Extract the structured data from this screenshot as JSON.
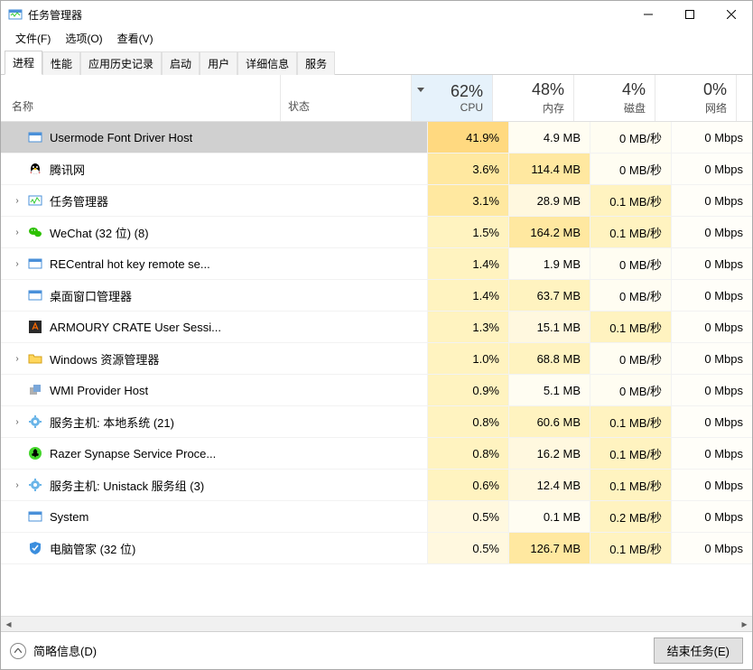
{
  "window": {
    "title": "任务管理器"
  },
  "menu": {
    "file": "文件(F)",
    "options": "选项(O)",
    "view": "查看(V)"
  },
  "tabs": {
    "processes": "进程",
    "performance": "性能",
    "app_history": "应用历史记录",
    "startup": "启动",
    "users": "用户",
    "details": "详细信息",
    "services": "服务"
  },
  "columns": {
    "name": "名称",
    "status": "状态",
    "cpu": {
      "pct": "62%",
      "label": "CPU"
    },
    "memory": {
      "pct": "48%",
      "label": "内存"
    },
    "disk": {
      "pct": "4%",
      "label": "磁盘"
    },
    "network": {
      "pct": "0%",
      "label": "网络"
    }
  },
  "rows": [
    {
      "name": "Usermode Font Driver Host",
      "cpu": "41.9%",
      "mem": "4.9 MB",
      "disk": "0 MB/秒",
      "net": "0 Mbps",
      "exp": false,
      "selected": true,
      "icon": "window"
    },
    {
      "name": "腾讯网",
      "cpu": "3.6%",
      "mem": "114.4 MB",
      "disk": "0 MB/秒",
      "net": "0 Mbps",
      "exp": false,
      "icon": "qq"
    },
    {
      "name": "任务管理器",
      "cpu": "3.1%",
      "mem": "28.9 MB",
      "disk": "0.1 MB/秒",
      "net": "0 Mbps",
      "exp": true,
      "icon": "taskmgr"
    },
    {
      "name": "WeChat (32 位) (8)",
      "cpu": "1.5%",
      "mem": "164.2 MB",
      "disk": "0.1 MB/秒",
      "net": "0 Mbps",
      "exp": true,
      "icon": "wechat"
    },
    {
      "name": "RECentral hot key remote se...",
      "cpu": "1.4%",
      "mem": "1.9 MB",
      "disk": "0 MB/秒",
      "net": "0 Mbps",
      "exp": true,
      "icon": "window"
    },
    {
      "name": "桌面窗口管理器",
      "cpu": "1.4%",
      "mem": "63.7 MB",
      "disk": "0 MB/秒",
      "net": "0 Mbps",
      "exp": false,
      "icon": "window"
    },
    {
      "name": "ARMOURY CRATE User Sessi...",
      "cpu": "1.3%",
      "mem": "15.1 MB",
      "disk": "0.1 MB/秒",
      "net": "0 Mbps",
      "exp": false,
      "icon": "armoury"
    },
    {
      "name": "Windows 资源管理器",
      "cpu": "1.0%",
      "mem": "68.8 MB",
      "disk": "0 MB/秒",
      "net": "0 Mbps",
      "exp": true,
      "icon": "explorer"
    },
    {
      "name": "WMI Provider Host",
      "cpu": "0.9%",
      "mem": "5.1 MB",
      "disk": "0 MB/秒",
      "net": "0 Mbps",
      "exp": false,
      "icon": "wmi"
    },
    {
      "name": "服务主机: 本地系统 (21)",
      "cpu": "0.8%",
      "mem": "60.6 MB",
      "disk": "0.1 MB/秒",
      "net": "0 Mbps",
      "exp": true,
      "icon": "gear"
    },
    {
      "name": "Razer Synapse Service Proce...",
      "cpu": "0.8%",
      "mem": "16.2 MB",
      "disk": "0.1 MB/秒",
      "net": "0 Mbps",
      "exp": false,
      "icon": "razer"
    },
    {
      "name": "服务主机: Unistack 服务组 (3)",
      "cpu": "0.6%",
      "mem": "12.4 MB",
      "disk": "0.1 MB/秒",
      "net": "0 Mbps",
      "exp": true,
      "icon": "gear"
    },
    {
      "name": "System",
      "cpu": "0.5%",
      "mem": "0.1 MB",
      "disk": "0.2 MB/秒",
      "net": "0 Mbps",
      "exp": false,
      "icon": "window"
    },
    {
      "name": "电脑管家 (32 位)",
      "cpu": "0.5%",
      "mem": "126.7 MB",
      "disk": "0.1 MB/秒",
      "net": "0 Mbps",
      "exp": false,
      "icon": "guanjia"
    }
  ],
  "footer": {
    "details": "简略信息(D)",
    "end_task": "结束任务(E)"
  }
}
